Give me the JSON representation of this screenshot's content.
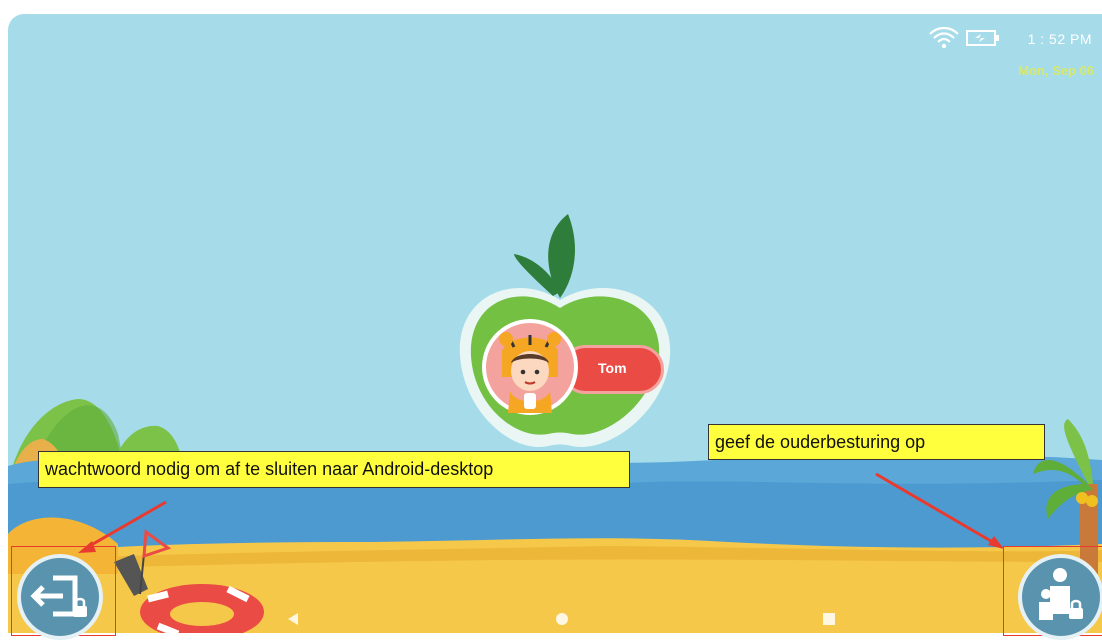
{
  "status_bar": {
    "time": "1 : 52 PM",
    "date": "Mon, Sep 06",
    "icons": [
      "wifi-icon",
      "battery-charging-icon"
    ]
  },
  "profile": {
    "name": "Tom",
    "avatar": "tiger-costume-child-avatar"
  },
  "callouts": {
    "exit": "wachtwoord nodig om af te sluiten naar Android-desktop",
    "parent": "geef de ouderbesturing op"
  },
  "buttons": {
    "exit": "exit-lock-icon",
    "parent_control": "parent-lock-icon"
  },
  "nav_bar": [
    "back-icon",
    "home-icon",
    "recents-icon"
  ],
  "colors": {
    "sky": "#a6dce9",
    "sea": "#5aa7d8",
    "sand": "#f6c84a",
    "apple_green": "#73c043",
    "name_pill": "#ea4b45",
    "callout_bg": "#ffff3d",
    "callout_border_red": "#e83a2f",
    "button_blue": "#5a93ad"
  }
}
